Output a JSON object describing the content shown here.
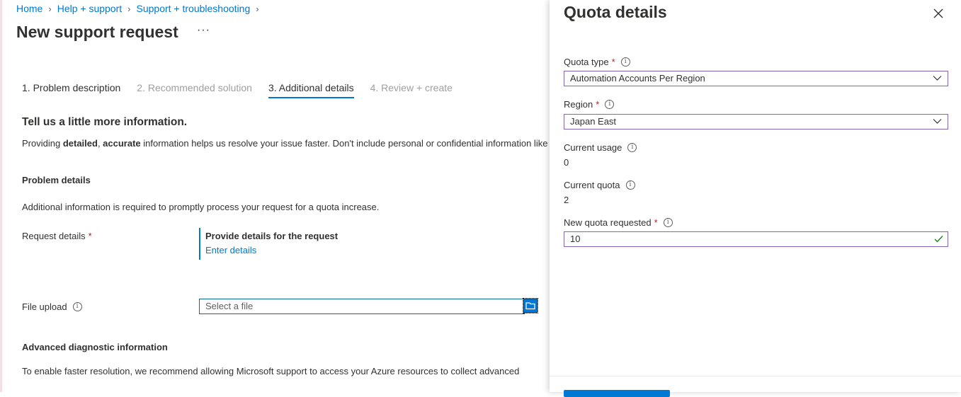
{
  "breadcrumb": {
    "items": [
      "Home",
      "Help + support",
      "Support + troubleshooting"
    ]
  },
  "page": {
    "title": "New support request",
    "more_label": "···"
  },
  "tabs": [
    {
      "label": "1. Problem description",
      "state": "done"
    },
    {
      "label": "2. Recommended solution",
      "state": "disabled"
    },
    {
      "label": "3. Additional details",
      "state": "active"
    },
    {
      "label": "4. Review + create",
      "state": "disabled"
    }
  ],
  "main": {
    "intro_heading": "Tell us a little more information.",
    "intro_prefix": "Providing ",
    "intro_bold1": "detailed",
    "intro_comma": ", ",
    "intro_bold2": "accurate",
    "intro_suffix": " information helps us resolve your issue faster. Don't include personal or confidential information like p",
    "problem_heading": "Problem details",
    "problem_text": "Additional information is required to promptly process your request for a quota increase.",
    "request_details_label": "Request details",
    "required_mark": "*",
    "details_title": "Provide details for the request",
    "details_link": "Enter details",
    "file_upload_label": "File upload",
    "file_placeholder": "Select a file",
    "advanced_heading": "Advanced diagnostic information",
    "advanced_text": "To enable faster resolution, we recommend allowing Microsoft support to access your Azure resources to collect advanced"
  },
  "panel": {
    "title": "Quota details",
    "quota_type_label": "Quota type",
    "quota_type_value": "Automation Accounts Per Region",
    "region_label": "Region",
    "region_value": "Japan East",
    "current_usage_label": "Current usage",
    "current_usage_value": "0",
    "current_quota_label": "Current quota",
    "current_quota_value": "2",
    "new_quota_label": "New quota requested",
    "new_quota_value": "10",
    "required_mark": "*"
  },
  "colors": {
    "accent": "#0078d4",
    "required": "#a4262c",
    "select_border": "#8764b8",
    "valid_check": "#107c10"
  },
  "icons": [
    "chevron-right-icon",
    "more-icon",
    "info-icon",
    "folder-icon",
    "close-icon",
    "chevron-down-icon",
    "checkmark-icon"
  ]
}
